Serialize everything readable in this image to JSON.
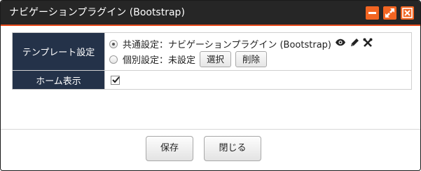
{
  "dialog": {
    "title": "ナビゲーションプラグイン (Bootstrap)",
    "accent_color": "#f26522",
    "titlebar_color": "#262626",
    "header_cell_color": "#243249",
    "window_buttons": [
      "minimize-icon",
      "maximize-icon",
      "close-icon"
    ]
  },
  "settings": {
    "template": {
      "label": "テンプレート設定",
      "common": {
        "text": "共通設定：ナビゲーションプラグイン (Bootstrap)",
        "selected": true,
        "icons": [
          "eye-icon",
          "pencil-icon",
          "tools-icon"
        ]
      },
      "individual": {
        "text": "個別設定：未設定",
        "selected": false,
        "select_label": "選択",
        "delete_label": "削除"
      }
    },
    "home_display": {
      "label": "ホーム表示",
      "checked": true
    }
  },
  "footer": {
    "save_label": "保存",
    "close_label": "閉じる"
  }
}
